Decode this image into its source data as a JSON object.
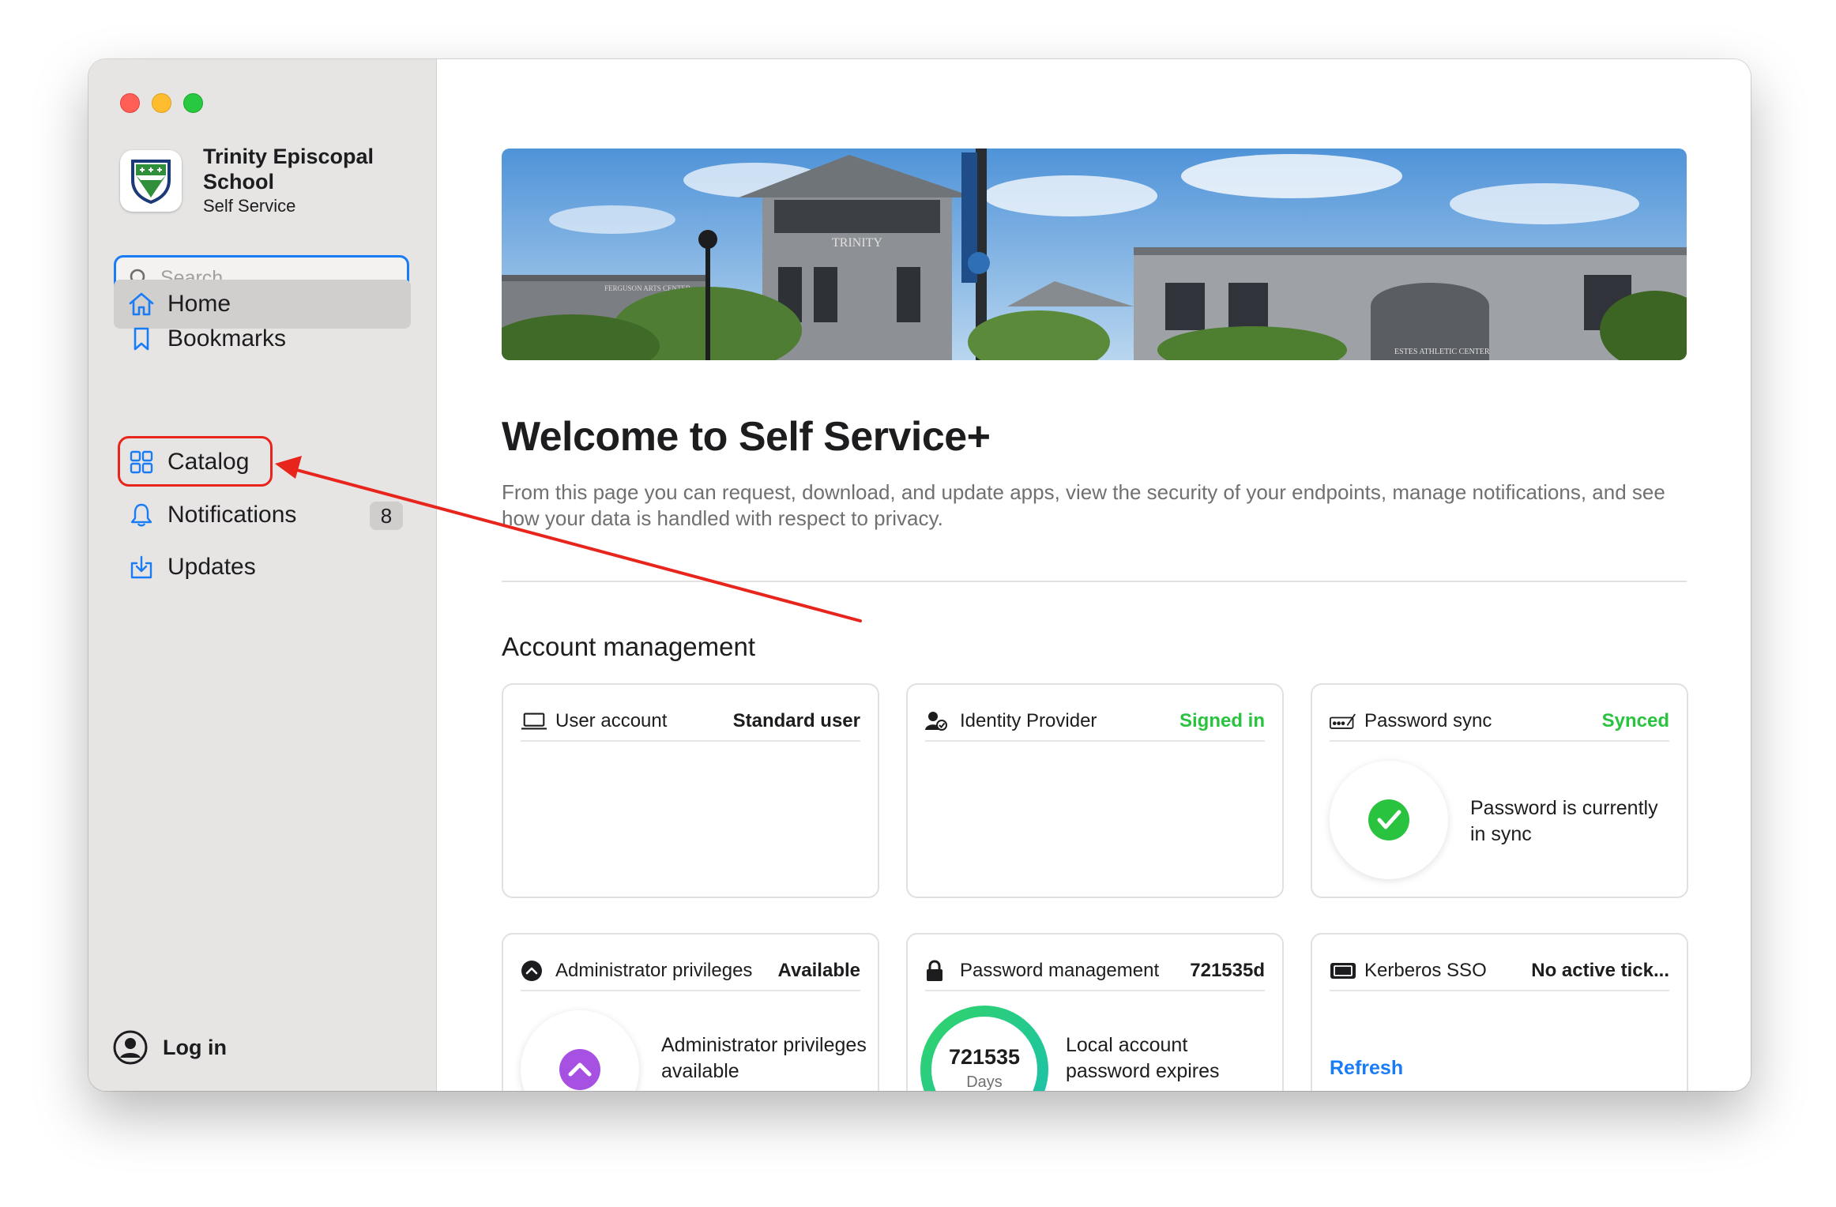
{
  "sidebar": {
    "org_name": "Trinity Episcopal School",
    "org_subtitle": "Self Service",
    "search_placeholder": "Search",
    "items": [
      {
        "label": "Home",
        "icon": "house-icon"
      },
      {
        "label": "Bookmarks",
        "icon": "bookmark-icon"
      },
      {
        "label": "Catalog",
        "icon": "grid-icon"
      },
      {
        "label": "Notifications",
        "icon": "bell-icon",
        "badge": "8"
      },
      {
        "label": "Updates",
        "icon": "download-tray-icon"
      }
    ],
    "login_label": "Log in"
  },
  "banner": {
    "building_sign": "TRINITY",
    "left_sign": "FERGUSON ARTS CENTER",
    "right_sign": "ESTES ATHLETIC CENTER"
  },
  "main": {
    "title": "Welcome to Self Service+",
    "description": "From this page you can request, download, and update apps, view the security of your endpoints, manage notifications, and see how your data is handled with respect to privacy.",
    "section_title": "Account management",
    "cards": [
      {
        "label": "User account",
        "value": "Standard user"
      },
      {
        "label": "Identity Provider",
        "value": "Signed in"
      },
      {
        "label": "Password sync",
        "value": "Synced",
        "body": "Password is currently in sync"
      },
      {
        "label": "Administrator privileges",
        "value": "Available",
        "body": "Administrator privileges available"
      },
      {
        "label": "Password management",
        "value": "721535d",
        "ring_value": "721535",
        "ring_unit": "Days",
        "body": "Local account password expires"
      },
      {
        "label": "Kerberos SSO",
        "value": "No active tick...",
        "action": "Refresh"
      }
    ]
  },
  "colors": {
    "accent": "#1a7cf5",
    "success": "#2ac33f",
    "annotation": "#e8251c",
    "admin_purple": "#a751e3"
  }
}
